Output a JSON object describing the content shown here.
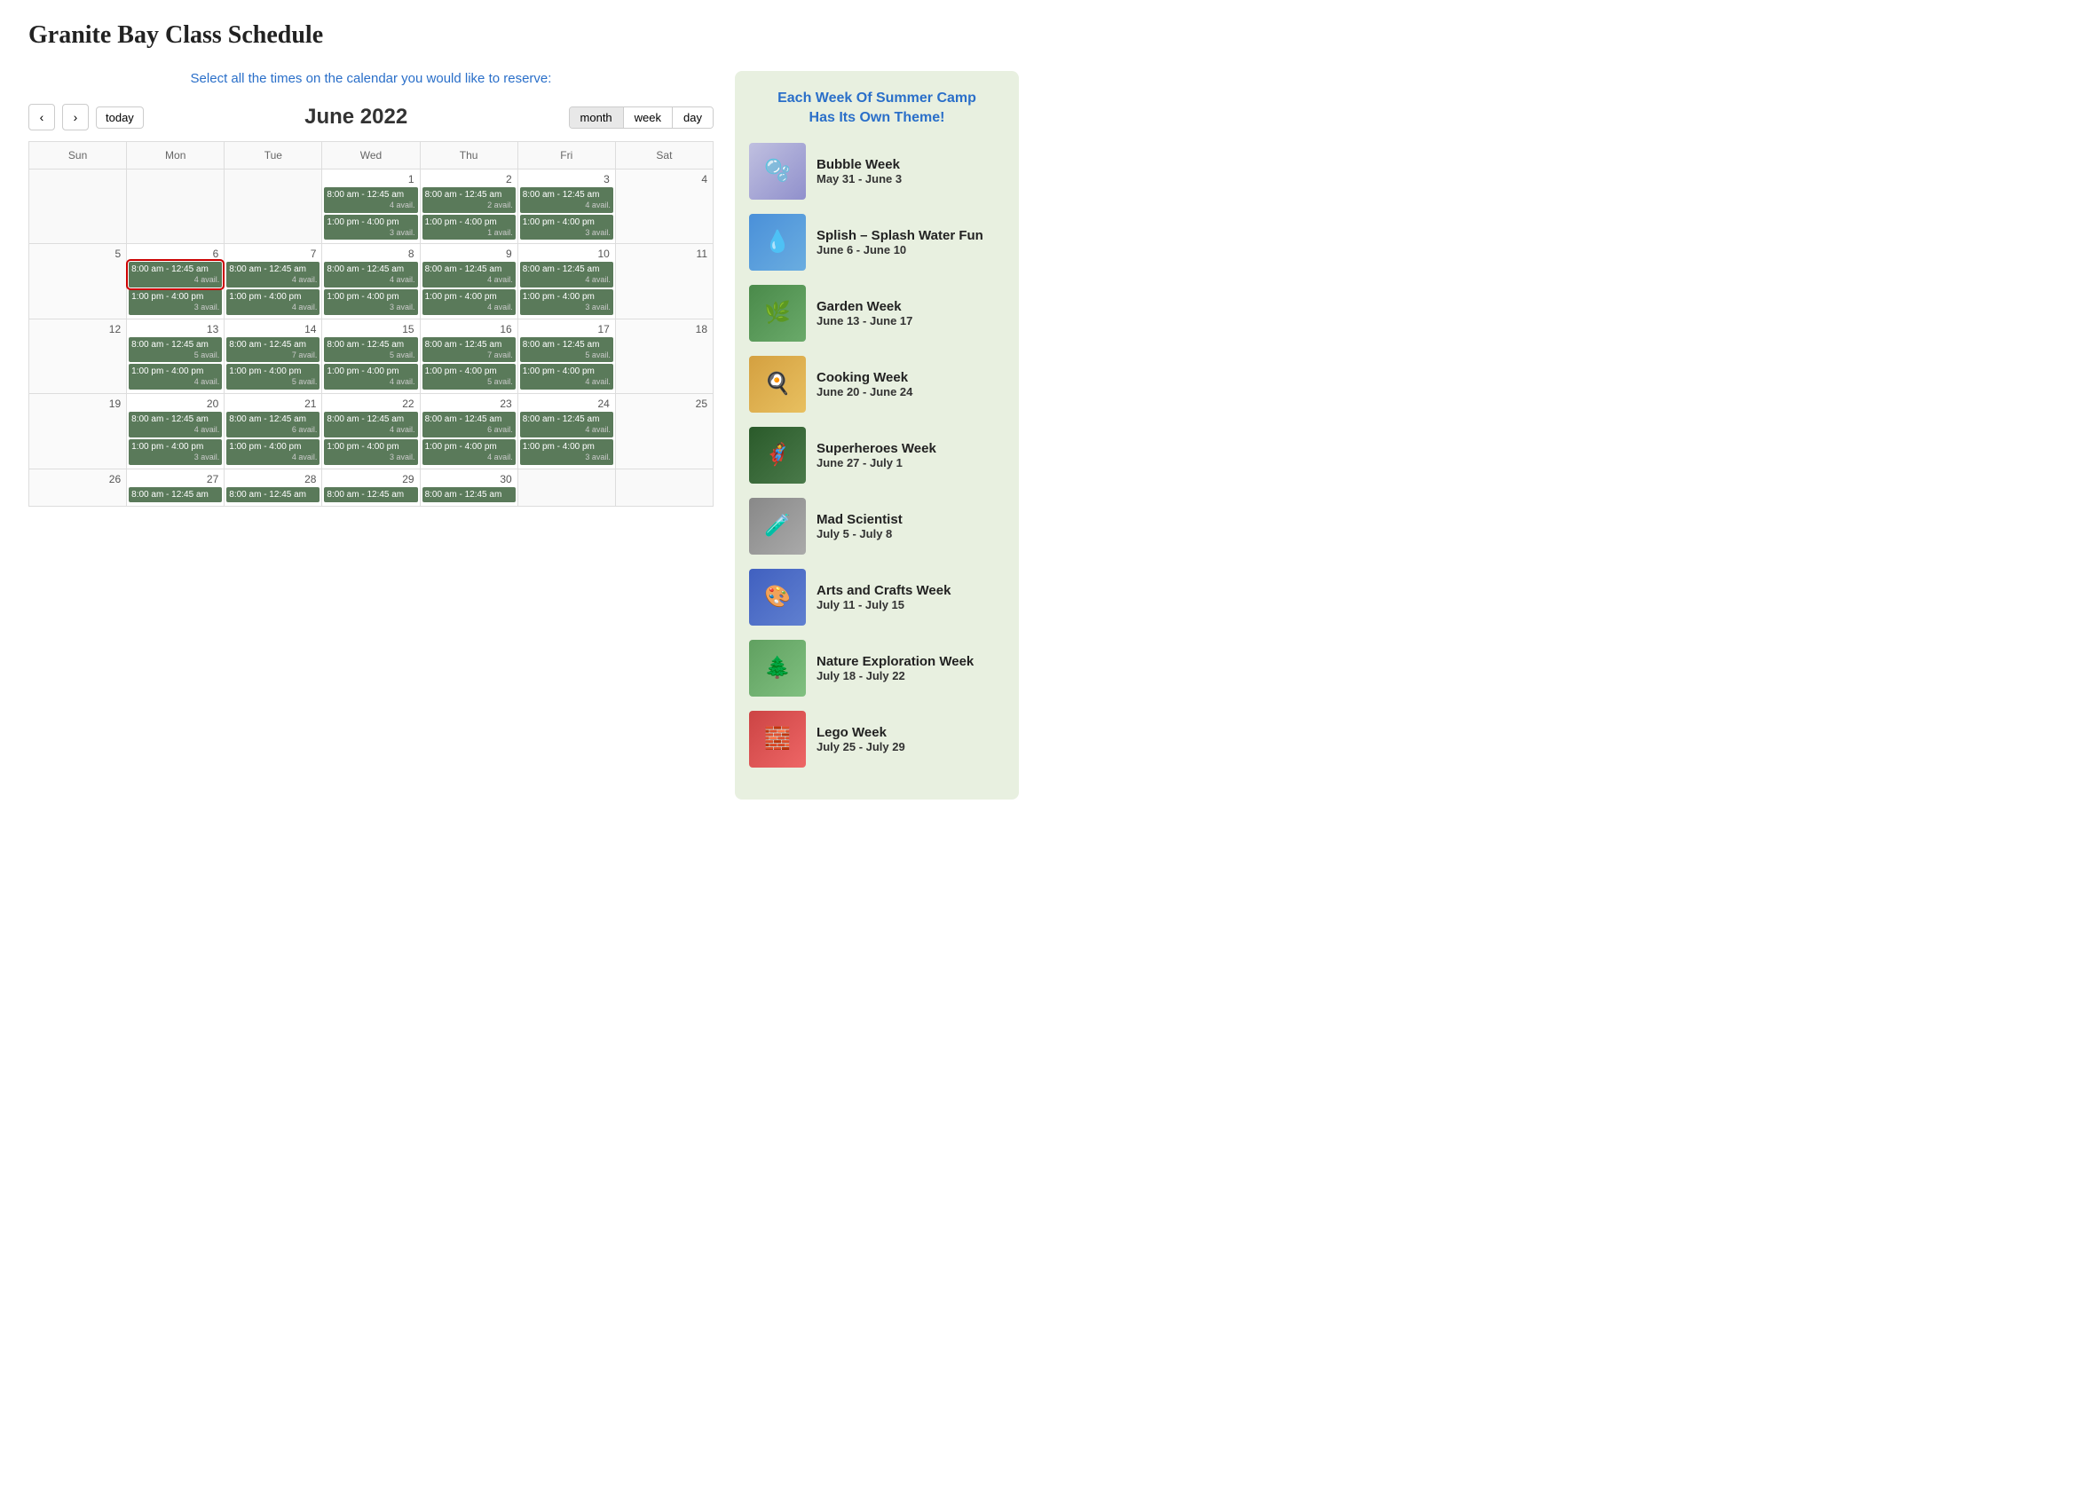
{
  "page": {
    "title": "Granite Bay Class Schedule"
  },
  "instruction": "Select all the times on the calendar you would like to reserve:",
  "calendar": {
    "month_year": "June 2022",
    "view_buttons": [
      "month",
      "week",
      "day"
    ],
    "active_view": "month",
    "days_of_week": [
      "Sun",
      "Mon",
      "Tue",
      "Wed",
      "Thu",
      "Fri",
      "Sat"
    ],
    "nav_prev": "<",
    "nav_next": ">",
    "today_label": "today"
  },
  "sidebar": {
    "title": "Each Week Of Summer Camp\nHas Its Own Theme!",
    "camps": [
      {
        "name": "Bubble Week",
        "dates": "May 31 - June 3",
        "thumb_class": "thumb-bubble",
        "icon": "🫧"
      },
      {
        "name": "Splish – Splash Water Fun",
        "dates": "June 6 - June 10",
        "thumb_class": "thumb-water",
        "icon": "💧"
      },
      {
        "name": "Garden Week",
        "dates": "June 13 - June 17",
        "thumb_class": "thumb-garden",
        "icon": "🌿"
      },
      {
        "name": "Cooking Week",
        "dates": "June 20 - June 24",
        "thumb_class": "thumb-cooking",
        "icon": "🍳"
      },
      {
        "name": "Superheroes Week",
        "dates": "June 27 - July 1",
        "thumb_class": "thumb-super",
        "icon": "🦸"
      },
      {
        "name": "Mad Scientist",
        "dates": "July 5 - July 8",
        "thumb_class": "thumb-mad",
        "icon": "🧪"
      },
      {
        "name": "Arts and Crafts Week",
        "dates": "July 11 - July 15",
        "thumb_class": "thumb-arts",
        "icon": "🎨"
      },
      {
        "name": "Nature Exploration Week",
        "dates": "July 18 - July 22",
        "thumb_class": "thumb-nature",
        "icon": "🌲"
      },
      {
        "name": "Lego Week",
        "dates": "July 25 - July 29",
        "thumb_class": "thumb-lego",
        "icon": "🧱"
      }
    ]
  },
  "cal_rows": [
    [
      {
        "day": "",
        "events": [],
        "empty": true
      },
      {
        "day": "",
        "events": [],
        "empty": true
      },
      {
        "day": "",
        "events": [],
        "empty": true
      },
      {
        "day": "1",
        "events": [
          {
            "time": "8:00 am - 12:45 am",
            "avail": "4 avail."
          },
          {
            "time": "1:00 pm - 4:00 pm",
            "avail": "3 avail."
          }
        ]
      },
      {
        "day": "2",
        "events": [
          {
            "time": "8:00 am - 12:45 am",
            "avail": "2 avail."
          },
          {
            "time": "1:00 pm - 4:00 pm",
            "avail": "1 avail."
          }
        ]
      },
      {
        "day": "3",
        "events": [
          {
            "time": "8:00 am - 12:45 am",
            "avail": "4 avail."
          },
          {
            "time": "1:00 pm - 4:00 pm",
            "avail": "3 avail."
          }
        ]
      },
      {
        "day": "4",
        "events": [],
        "weekend": true
      }
    ],
    [
      {
        "day": "5",
        "events": [],
        "weekend": true
      },
      {
        "day": "6",
        "events": [
          {
            "time": "8:00 am - 12:45 am",
            "avail": "4 avail.",
            "selected": true
          },
          {
            "time": "1:00 pm - 4:00 pm",
            "avail": "3 avail."
          }
        ]
      },
      {
        "day": "7",
        "events": [
          {
            "time": "8:00 am - 12:45 am",
            "avail": "4 avail."
          },
          {
            "time": "1:00 pm - 4:00 pm",
            "avail": "4 avail."
          }
        ]
      },
      {
        "day": "8",
        "events": [
          {
            "time": "8:00 am - 12:45 am",
            "avail": "4 avail."
          },
          {
            "time": "1:00 pm - 4:00 pm",
            "avail": "3 avail."
          }
        ]
      },
      {
        "day": "9",
        "events": [
          {
            "time": "8:00 am - 12:45 am",
            "avail": "4 avail."
          },
          {
            "time": "1:00 pm - 4:00 pm",
            "avail": "4 avail."
          }
        ]
      },
      {
        "day": "10",
        "events": [
          {
            "time": "8:00 am - 12:45 am",
            "avail": "4 avail."
          },
          {
            "time": "1:00 pm - 4:00 pm",
            "avail": "3 avail."
          }
        ]
      },
      {
        "day": "11",
        "events": [],
        "weekend": true
      }
    ],
    [
      {
        "day": "12",
        "events": [],
        "weekend": true
      },
      {
        "day": "13",
        "events": [
          {
            "time": "8:00 am - 12:45 am",
            "avail": "5 avail."
          },
          {
            "time": "1:00 pm - 4:00 pm",
            "avail": "4 avail."
          }
        ]
      },
      {
        "day": "14",
        "events": [
          {
            "time": "8:00 am - 12:45 am",
            "avail": "7 avail."
          },
          {
            "time": "1:00 pm - 4:00 pm",
            "avail": "5 avail."
          }
        ]
      },
      {
        "day": "15",
        "events": [
          {
            "time": "8:00 am - 12:45 am",
            "avail": "5 avail."
          },
          {
            "time": "1:00 pm - 4:00 pm",
            "avail": "4 avail."
          }
        ]
      },
      {
        "day": "16",
        "events": [
          {
            "time": "8:00 am - 12:45 am",
            "avail": "7 avail."
          },
          {
            "time": "1:00 pm - 4:00 pm",
            "avail": "5 avail."
          }
        ]
      },
      {
        "day": "17",
        "events": [
          {
            "time": "8:00 am - 12:45 am",
            "avail": "5 avail."
          },
          {
            "time": "1:00 pm - 4:00 pm",
            "avail": "4 avail."
          }
        ]
      },
      {
        "day": "18",
        "events": [],
        "weekend": true
      }
    ],
    [
      {
        "day": "19",
        "events": [],
        "weekend": true
      },
      {
        "day": "20",
        "events": [
          {
            "time": "8:00 am - 12:45 am",
            "avail": "4 avail."
          },
          {
            "time": "1:00 pm - 4:00 pm",
            "avail": "3 avail."
          }
        ]
      },
      {
        "day": "21",
        "events": [
          {
            "time": "8:00 am - 12:45 am",
            "avail": "6 avail."
          },
          {
            "time": "1:00 pm - 4:00 pm",
            "avail": "4 avail."
          }
        ]
      },
      {
        "day": "22",
        "events": [
          {
            "time": "8:00 am - 12:45 am",
            "avail": "4 avail."
          },
          {
            "time": "1:00 pm - 4:00 pm",
            "avail": "3 avail."
          }
        ]
      },
      {
        "day": "23",
        "events": [
          {
            "time": "8:00 am - 12:45 am",
            "avail": "6 avail."
          },
          {
            "time": "1:00 pm - 4:00 pm",
            "avail": "4 avail."
          }
        ]
      },
      {
        "day": "24",
        "events": [
          {
            "time": "8:00 am - 12:45 am",
            "avail": "4 avail."
          },
          {
            "time": "1:00 pm - 4:00 pm",
            "avail": "3 avail."
          }
        ]
      },
      {
        "day": "25",
        "events": [],
        "weekend": true
      }
    ],
    [
      {
        "day": "26",
        "events": [],
        "weekend": true
      },
      {
        "day": "27",
        "events": [
          {
            "time": "8:00 am - 12:45 am",
            "avail": ""
          }
        ]
      },
      {
        "day": "28",
        "events": [
          {
            "time": "8:00 am - 12:45 am",
            "avail": ""
          }
        ]
      },
      {
        "day": "29",
        "events": [
          {
            "time": "8:00 am - 12:45 am",
            "avail": ""
          }
        ]
      },
      {
        "day": "30",
        "events": [
          {
            "time": "8:00 am - 12:45 am",
            "avail": ""
          }
        ]
      },
      {
        "day": "",
        "events": [],
        "empty": true
      },
      {
        "day": "",
        "events": [],
        "empty": true
      }
    ]
  ]
}
